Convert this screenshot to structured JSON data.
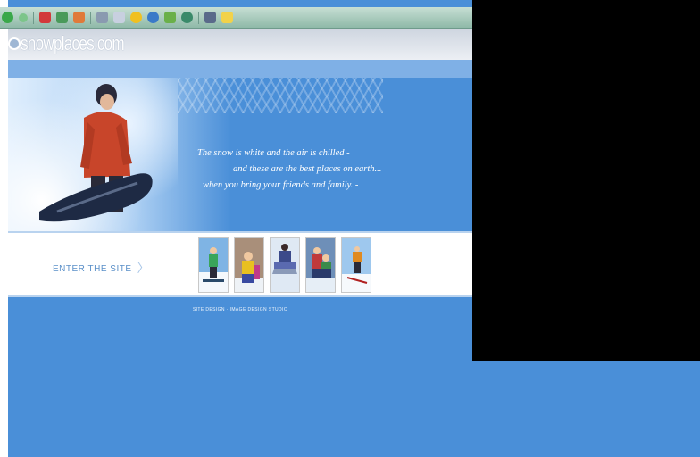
{
  "browser": {
    "toolbar_icons": [
      "back-icon",
      "forward-icon",
      "stop-icon",
      "refresh-icon",
      "home-icon",
      "print-icon",
      "mail-icon",
      "favorites-icon",
      "globe-icon",
      "media-icon",
      "history-icon",
      "edit-icon",
      "folder-icon"
    ]
  },
  "site": {
    "logo_text": "snowplaces.com",
    "quote": {
      "line1": "The snow is white and the air is chilled -",
      "line2": "and these are the best places on earth...",
      "line3": "when you bring your friends and family. -"
    },
    "enter_label": "ENTER THE SITE",
    "enter_chevron": "〉",
    "thumbnails": [
      {
        "name": "snowboarder-green",
        "jacket": "#3aa55a",
        "bg": "#7fb4e4"
      },
      {
        "name": "family-yellow-coat",
        "jacket": "#e8c020",
        "bg": "#a98f7a"
      },
      {
        "name": "sledding-group",
        "jacket": "#3b4a8a",
        "bg": "#dfe9f4"
      },
      {
        "name": "children-in-snow",
        "jacket": "#c03a3a",
        "bg": "#6e8fb8"
      },
      {
        "name": "skier-orange",
        "jacket": "#e08a20",
        "bg": "#9ec8ee"
      }
    ],
    "footer_text": "SITE DESIGN · IMAGE DESIGN STUDIO"
  },
  "colors": {
    "page_blue": "#4a8fd8",
    "band_light": "#7fb0e6",
    "toolbar": "#a8cbbd"
  }
}
